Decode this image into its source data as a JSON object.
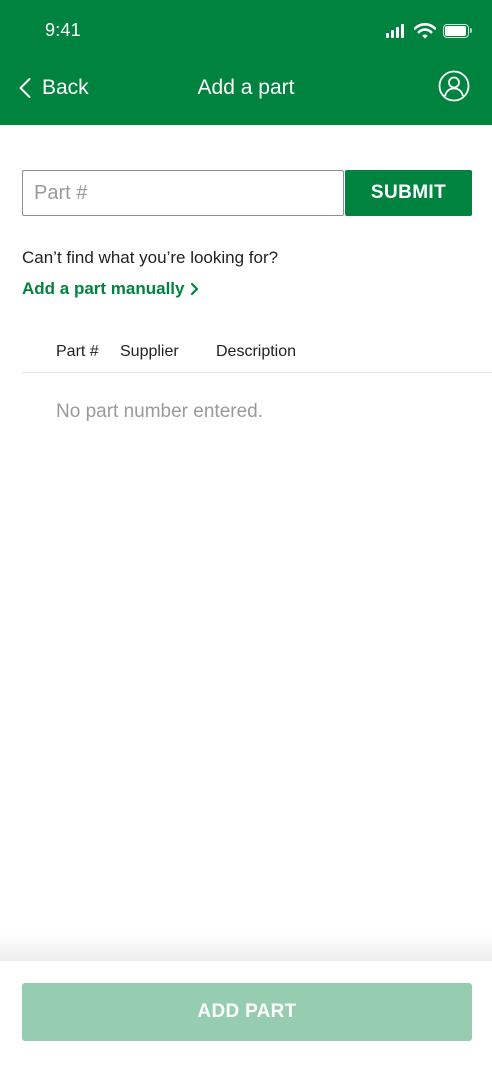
{
  "status_bar": {
    "time": "9:41",
    "icons": [
      "signal-icon",
      "wifi-icon",
      "battery-icon"
    ]
  },
  "header": {
    "back_label": "Back",
    "title": "Add a part",
    "back_icon": "chevron-left-icon",
    "profile_icon": "user-circle-icon",
    "background_color": "#00833e"
  },
  "search": {
    "placeholder": "Part #",
    "value": "",
    "submit_label": "SUBMIT"
  },
  "help": {
    "question": "Can’t find what you’re looking for?",
    "manual_link_label": "Add a part manually",
    "link_icon": "chevron-right-icon"
  },
  "table": {
    "columns": [
      "Part #",
      "Supplier",
      "Description"
    ],
    "empty_message": "No part number entered."
  },
  "footer": {
    "add_part_label": "ADD PART",
    "add_part_color": "#96cdb0",
    "add_part_enabled": false
  }
}
